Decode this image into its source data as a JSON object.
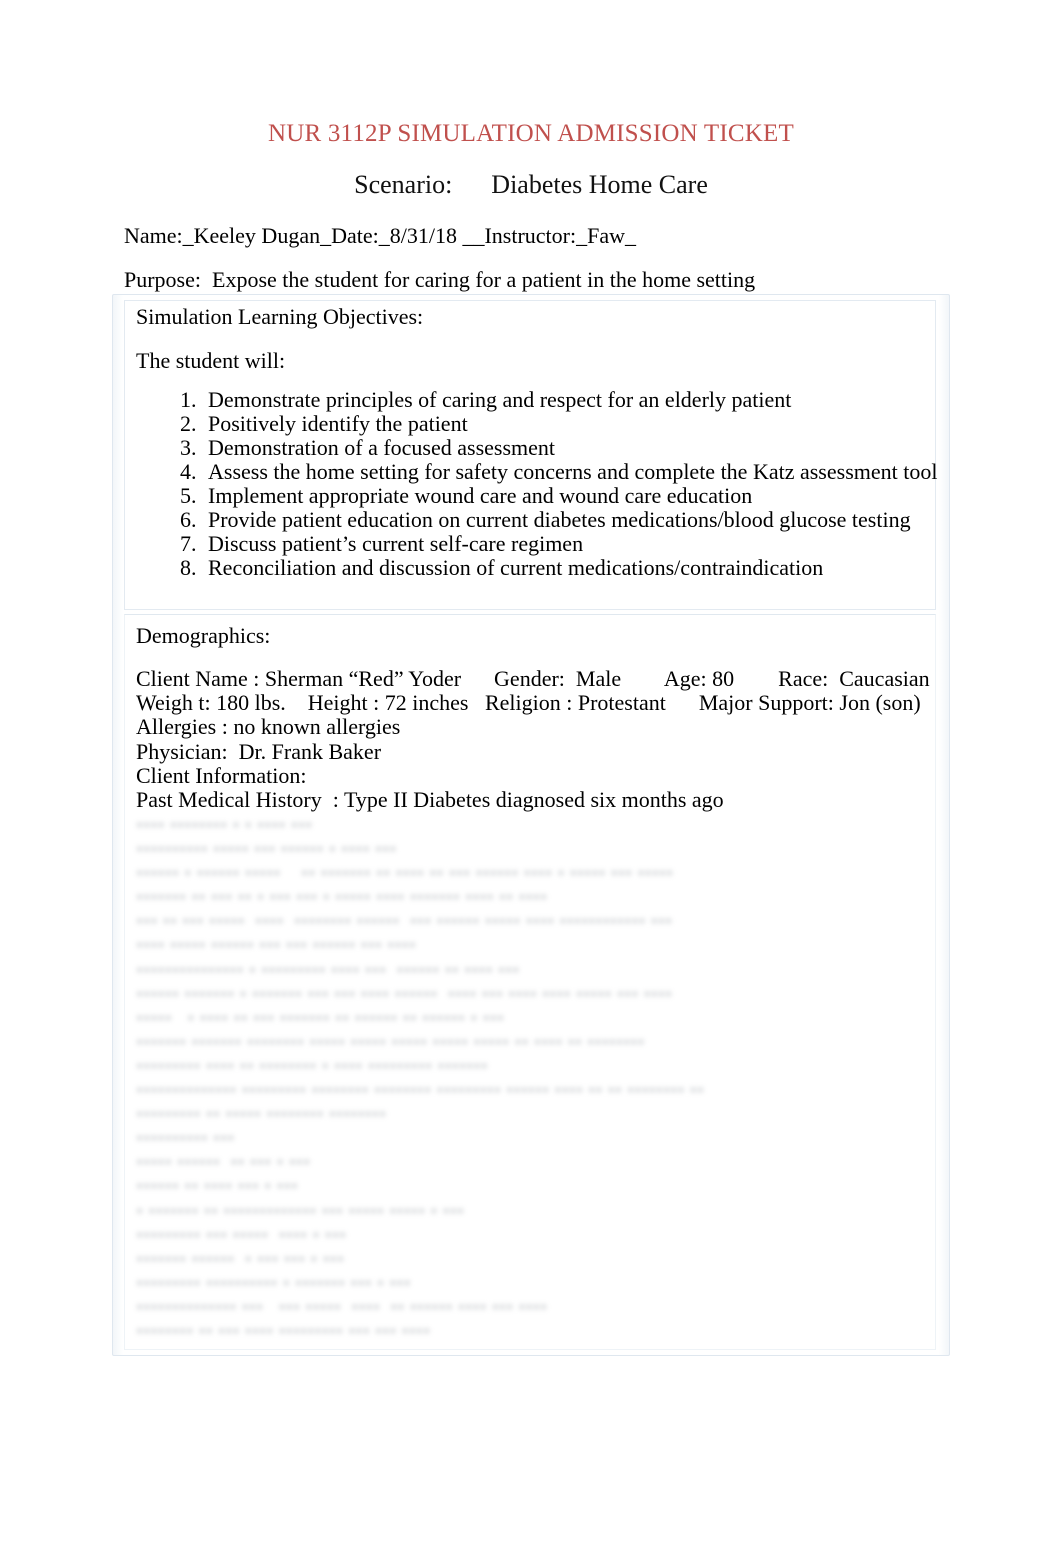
{
  "document": {
    "title": "NUR 3112P SIMULATION ADMISSION TICKET",
    "title_color": "#C0504D",
    "subtitle": "Scenario:      Diabetes Home Care",
    "name_line": "Name:_Keeley Dugan_Date:_8/31/18 __Instructor:_Faw_",
    "purpose_line": "Purpose:  Expose the student for caring for a patient in the home setting"
  },
  "objectives": {
    "heading": "Simulation Learning Objectives:",
    "lead_in": "The student will:",
    "items": [
      "Demonstrate principles of caring and respect for an elderly patient",
      "Positively identify the patient",
      "Demonstration of a focused assessment",
      "Assess the home setting for safety concerns and complete the Katz assessment tool",
      "Implement appropriate wound care and wound care education",
      "Provide patient education on current diabetes medications/blood glucose testing",
      "Discuss patient’s current self-care regimen",
      "Reconciliation and discussion of current medications/contraindication"
    ]
  },
  "demographics": {
    "heading": "Demographics:",
    "lines": [
      "Client Name : Sherman “Red” Yoder      Gender:  Male        Age: 80        Race:  Caucasian",
      "Weigh t: 180 lbs.    Height : 72 inches   Religion : Protestant      Major Support: Jon (son)",
      "Allergies : no known allergies",
      "Physician:  Dr. Frank Baker",
      "Client Information:",
      "Past Medical History  : Type II Diabetes diagnosed six months ago"
    ]
  },
  "redacted": {
    "note": "illegible blurred text block",
    "lines": [
      "•••• •••••••• • • •••• •••",
      "•••••••••• ••••• ••• •••••• • •••• •••",
      "•••••• • •••••• •••••    •• ••••••• •• •••• •• ••• •••••• •••• • ••••• ••• •••••",
      "••••••• •• ••• •• • ••• ••• • ••••• •••• ••••••• •••• •• ••••",
      "••• •• ••• •••••  ••••  •••••••• ••••••  ••• •••••• ••••• •••• •••••••••••• •••",
      "•••• ••••• •••••• ••• ••• •••••• ••• ••••",
      "••••••••••••••• • ••••••••• •••• •••  •••••• •• •••• •••",
      "•••••• ••••••• • ••••••• ••• ••• •••• ••••••  •••• ••• •••• •••• ••••• ••• ••••",
      "•••••   • •••• •• ••• ••••••• •• •••••• •• •••••• • •••",
      "••••••• ••••••• •••••••• ••••• ••••• ••••• ••••• ••••• •• •••• •• ••••••••",
      "••••••••• •••• •• •••••••• • •••• ••••••••• •••••••",
      "•••••••••••••• ••••••••• •••••••• •••••••• ••••••••• •••••• •••• •• •• •••••••• ••",
      "••••••••• •• ••••• •••••••• ••••••••",
      "•••••••••• •••",
      "••••• ••••••  •• ••• • •••",
      "•••••• •• •••• ••• • •••",
      "• ••••••• •• ••••••••••••• ••• ••••• ••••• • •••",
      "••••••••• ••• •••••  •••• • •••",
      "••••••• ••••••  • ••• ••• • •••",
      "••••••••• •••••••••• • ••••••• ••• • •••",
      "•••••••••••••• •••   ••• •••••  ••••  •• •••••• •••• ••• ••••",
      "•••••••• •• ••• •••• ••••••••• ••• ••• ••••"
    ]
  }
}
